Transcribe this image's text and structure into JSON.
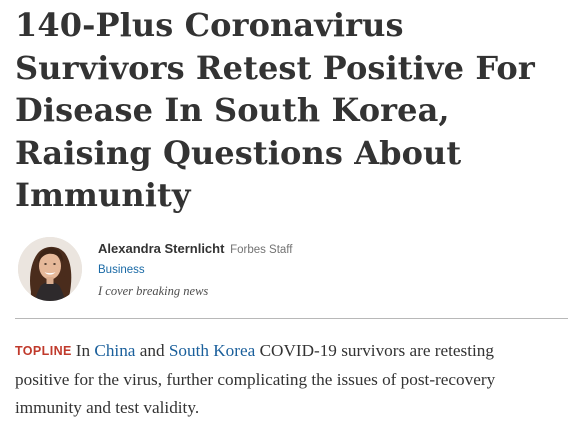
{
  "article": {
    "headline_lines": [
      "140-Plus Coronavirus",
      "Survivors Retest Positive For",
      "Disease In South Korea,",
      "Raising Questions About",
      "Immunity"
    ]
  },
  "author": {
    "name": "Alexandra Sternlicht",
    "role": "Forbes Staff",
    "channel": "Business",
    "bio": "I cover breaking news"
  },
  "summary": {
    "label": "TOPLINE",
    "intro": "In ",
    "link_1": "China",
    "and": " and ",
    "link_2": "South Korea",
    "rest_line1": " COVID-19 survivors are retesting",
    "line2": "positive for the virus, further complicating the issues of post-recovery",
    "line3": "immunity and test validity."
  },
  "colors": {
    "topline": "#c0392b",
    "link": "#1a5f9b",
    "channel": "#1a6aa6",
    "text": "#333333"
  }
}
